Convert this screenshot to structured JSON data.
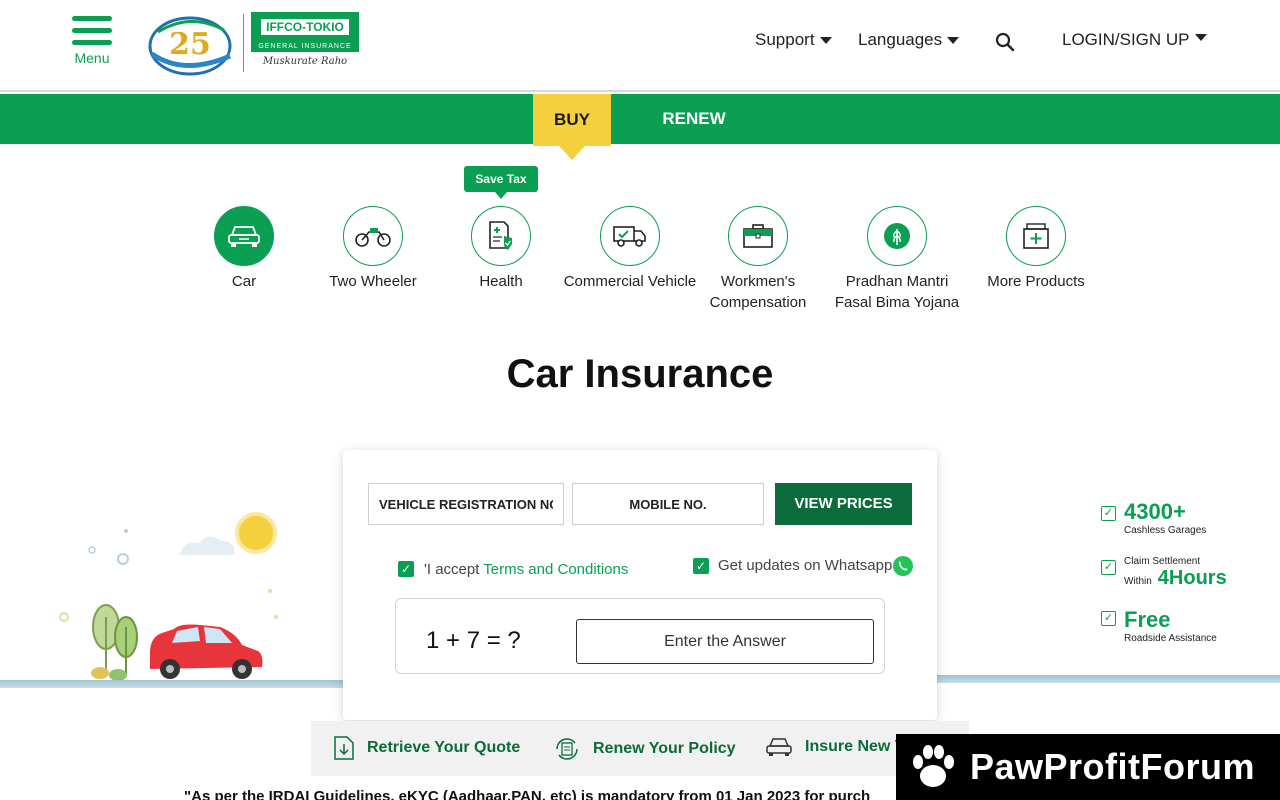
{
  "header": {
    "menu_label": "Menu",
    "logo_brand": "IFFCO-TOKIO",
    "logo_sub": "GENERAL INSURANCE",
    "logo_tagline": "Muskurate Raho",
    "logo_anniversary": "25",
    "nav": {
      "support": "Support",
      "languages": "Languages",
      "login": "LOGIN/SIGN UP"
    }
  },
  "tabs": {
    "buy": "BUY",
    "renew": "RENEW",
    "active": "BUY"
  },
  "products": {
    "badge": "Save Tax",
    "items": [
      {
        "label": "Car",
        "icon": "car-icon",
        "active": true
      },
      {
        "label": "Two Wheeler",
        "icon": "motorbike-icon",
        "active": false
      },
      {
        "label": "Health",
        "icon": "health-document-icon",
        "active": false
      },
      {
        "label": "Commercial Vehicle",
        "icon": "truck-icon",
        "active": false
      },
      {
        "label": "Workmen's Compensation",
        "icon": "briefcase-icon",
        "active": false
      },
      {
        "label": "Pradhan Mantri Fasal Bima Yojana",
        "icon": "crop-icon",
        "active": false
      },
      {
        "label": "More Products",
        "icon": "more-products-icon",
        "active": false
      }
    ]
  },
  "main": {
    "title": "Car Insurance"
  },
  "form": {
    "vehicle_placeholder": "VEHICLE REGISTRATION NO.",
    "mobile_placeholder": "MOBILE NO.",
    "submit_label": "VIEW PRICES",
    "terms_prefix": "'I accept ",
    "terms_link": "Terms and Conditions",
    "terms_checked": true,
    "whatsapp_label": "Get updates on Whatsapp",
    "whatsapp_checked": true,
    "captcha_question": "1 + 7 = ?",
    "captcha_placeholder": "Enter the Answer"
  },
  "features": [
    {
      "pre": "",
      "big": "4300+",
      "small": "Cashless Garages"
    },
    {
      "pre": "Claim Settlement",
      "within": "Within",
      "big": "4Hours",
      "small": ""
    },
    {
      "pre": "",
      "big": "Free",
      "small": "Roadside Assistance"
    }
  ],
  "quick_links": {
    "retrieve": "Retrieve Your Quote",
    "renew": "Renew Your Policy",
    "insure_new": "Insure New V"
  },
  "notice": "\"As per the IRDAI Guidelines, eKYC (Aadhaar,PAN, etc) is mandatory from 01 Jan 2023 for purch",
  "watermark": "PawProfitForum",
  "colors": {
    "brand_green": "#0a9f53",
    "dark_green": "#0c6b3a",
    "tab_yellow": "#f4d03f"
  }
}
